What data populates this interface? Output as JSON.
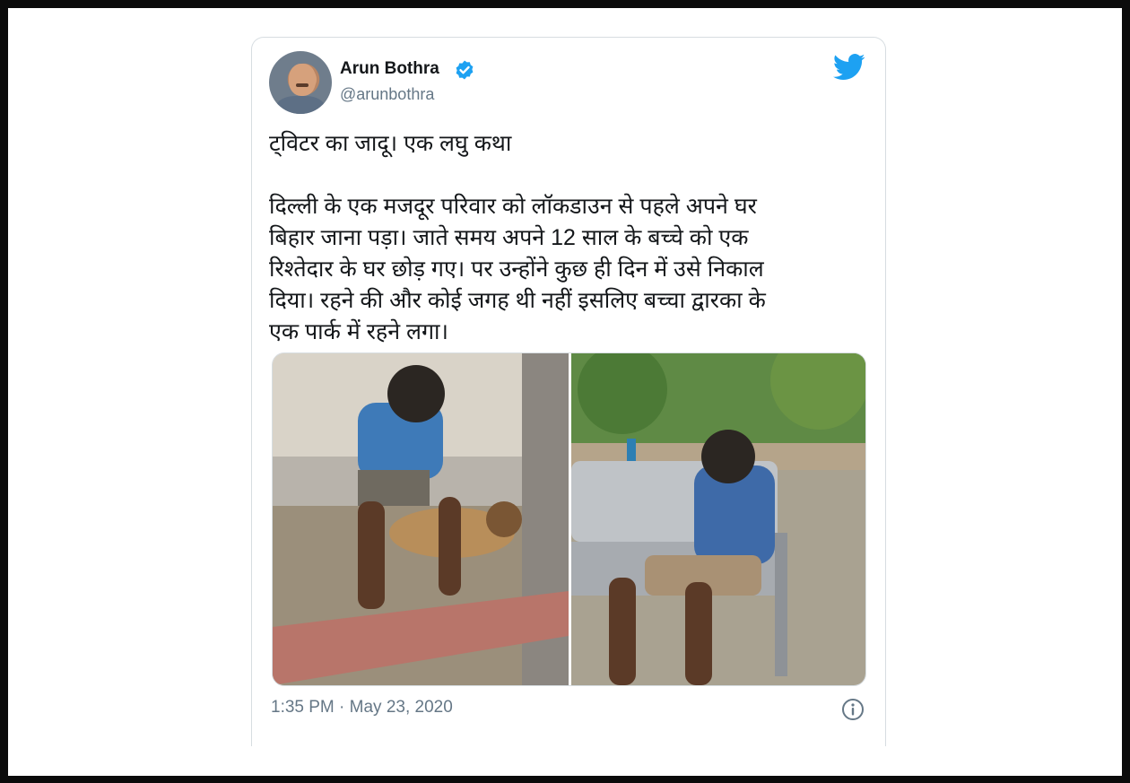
{
  "author": {
    "name": "Arun Bothra",
    "handle": "@arunbothra",
    "verified": true,
    "avatar_icon": "profile-photo"
  },
  "brand": {
    "logo_icon": "twitter-bird-icon",
    "accent_color": "#1da1f2"
  },
  "tweet": {
    "text": "ट्विटर का जादू। एक लघु कथा\n\nदिल्ली के एक मजदूर परिवार को लॉकडाउन से पहले अपने घर\nबिहार जाना पड़ा। जाते समय अपने 12 साल के बच्चे को एक\nरिश्तेदार के घर छोड़ गए। पर उन्होंने कुछ ही दिन में उसे निकाल\nदिया। रहने की और कोई जगह थी नहीं इसलिए बच्चा द्वारका के\nएक पार्क में रहने लगा।",
    "timestamp": "1:35 PM · May 23, 2020"
  },
  "media": {
    "count": 2
  },
  "icons": {
    "info": "info-icon"
  }
}
